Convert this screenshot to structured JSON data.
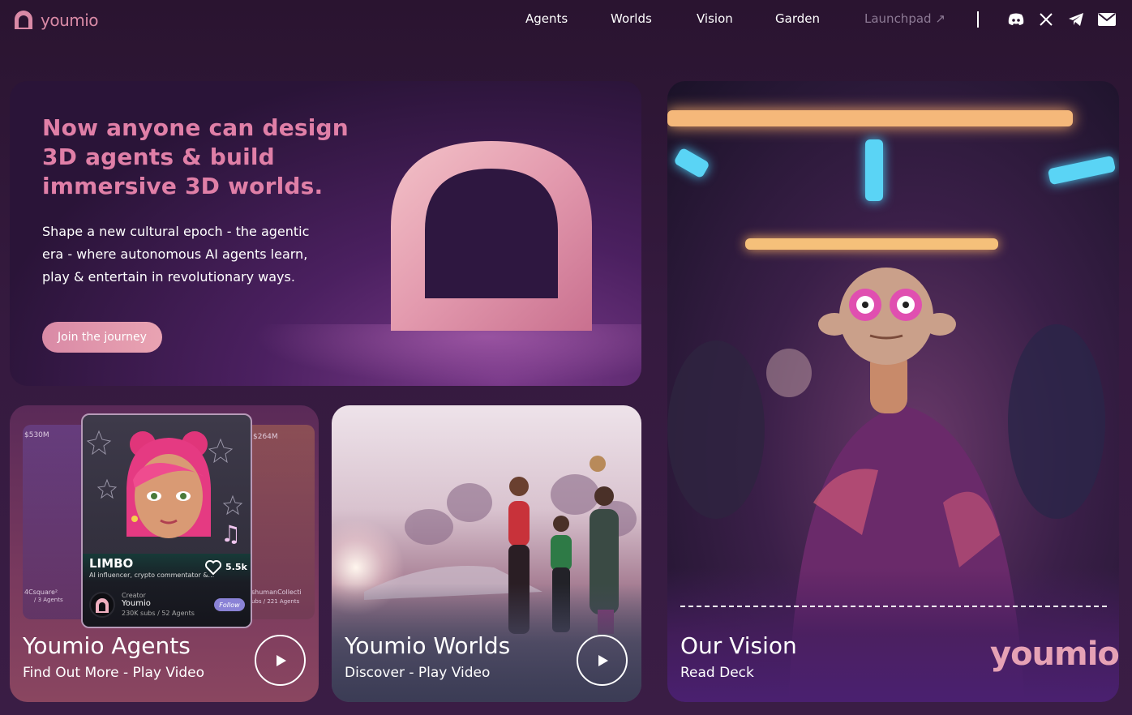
{
  "brand": {
    "name": "youmio"
  },
  "nav": {
    "links": [
      "Agents",
      "Worlds",
      "Vision",
      "Garden",
      "Launchpad ↗"
    ],
    "icons": [
      "discord-icon",
      "x-icon",
      "telegram-icon",
      "mail-icon"
    ]
  },
  "hero": {
    "title": "Now anyone can design 3D agents & build immersive 3D worlds.",
    "subtitle": "Shape a new cultural epoch - the agentic era - where autonomous AI agents learn, play & entertain in revolutionary ways.",
    "cta": "Join the journey"
  },
  "agents_card": {
    "title": "Youmio Agents",
    "subtitle": "Find Out More - Play Video",
    "bg_left_value": "$530M",
    "bg_right_value": "$264M",
    "bg_left_name": "4Csquare²",
    "bg_left_meta": "/ 3 Agents",
    "bg_right_name": "shumanCollecti",
    "bg_right_meta": "ubs / 221 Agents",
    "profile": {
      "name": "LIMBO",
      "description": "AI influencer, crypto commentator &...",
      "likes": "5.5k",
      "creator_label": "Creator",
      "creator_name": "Youmio",
      "creator_stats": "230K subs / 52 Agents",
      "follow_label": "Follow"
    }
  },
  "worlds_card": {
    "title": "Youmio Worlds",
    "subtitle": "Discover - Play Video"
  },
  "vision_card": {
    "title": "Our Vision",
    "subtitle": "Read Deck",
    "logo_text": "youmio"
  },
  "colors": {
    "accent": "#e07fa7",
    "background": "#2f173a",
    "button": "#d98aa6"
  }
}
